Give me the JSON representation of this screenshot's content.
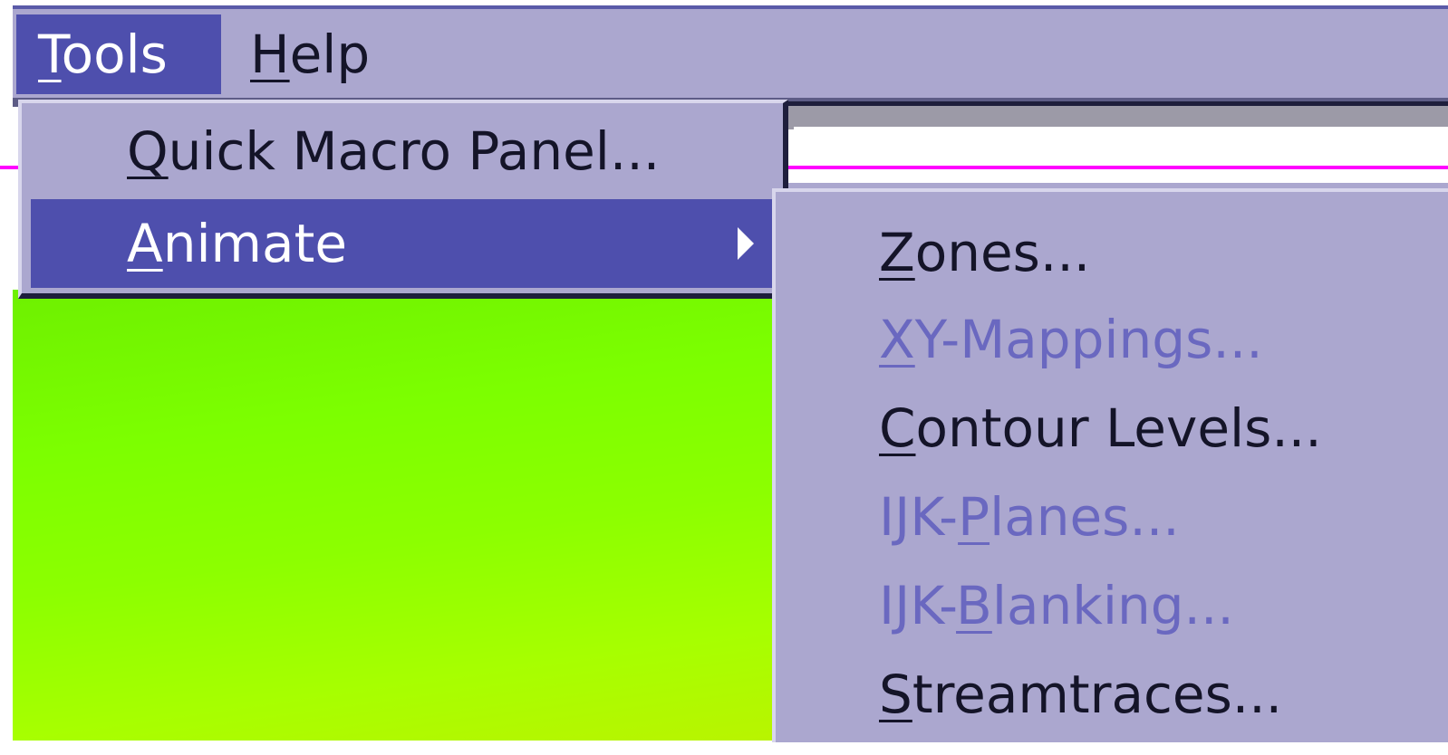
{
  "menubar": {
    "tools": {
      "label": "Tools",
      "mnemonic": "T",
      "rest": "ools"
    },
    "help": {
      "label": "Help",
      "mnemonic": "H",
      "rest": "elp"
    }
  },
  "tools_menu": {
    "items": [
      {
        "label": "Quick Macro Panel...",
        "mnemonic": "Q",
        "rest": "uick Macro Panel..."
      },
      {
        "label": "Animate",
        "mnemonic": "A",
        "rest": "nimate",
        "has_submenu": true,
        "highlighted": true
      }
    ]
  },
  "animate_submenu": {
    "items": [
      {
        "label": "Zones...",
        "before": "",
        "mnemonic": "Z",
        "after": "ones...",
        "enabled": true
      },
      {
        "label": "XY-Mappings...",
        "before": "",
        "mnemonic": "X",
        "after": "Y-Mappings...",
        "enabled": false
      },
      {
        "label": "Contour Levels...",
        "before": "",
        "mnemonic": "C",
        "after": "ontour Levels...",
        "enabled": true
      },
      {
        "label": "IJK-Planes...",
        "before": "IJK-",
        "mnemonic": "P",
        "after": "lanes...",
        "enabled": false
      },
      {
        "label": "IJK-Blanking...",
        "before": "IJK-",
        "mnemonic": "B",
        "after": "lanking...",
        "enabled": false
      },
      {
        "label": "Streamtraces...",
        "before": "",
        "mnemonic": "S",
        "after": "treamtraces...",
        "enabled": true
      }
    ]
  },
  "colors": {
    "menu_bg": "#aba7cf",
    "highlight": "#4e4fad",
    "disabled_text": "#6a68c0",
    "plot_green": "#7cff00",
    "magenta_line": "#ff00ff"
  },
  "icons": {
    "submenu_arrow": "triangle-right-icon"
  }
}
